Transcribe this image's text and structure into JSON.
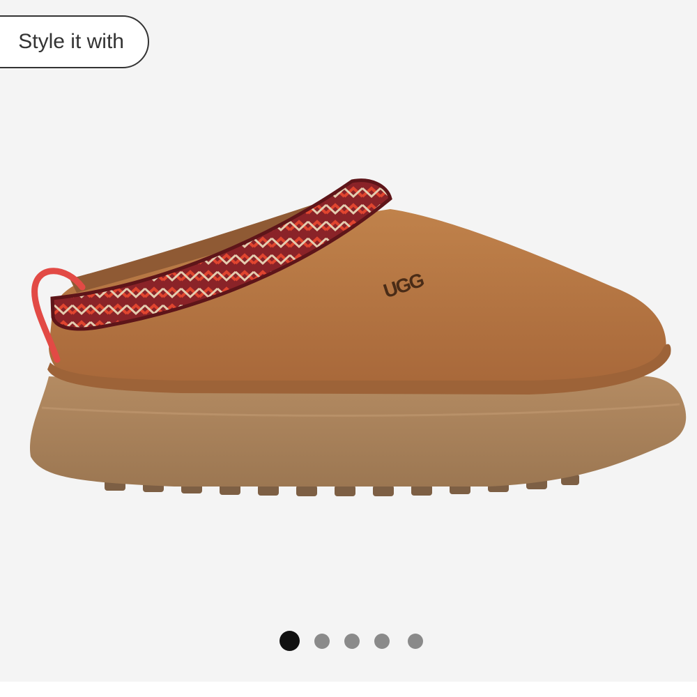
{
  "style_button": {
    "label": "Style it with"
  },
  "product_image": {
    "brand_logo": "UGG",
    "description_icon": "clog-slipper-image"
  },
  "carousel": {
    "count": 5,
    "active_index": 0
  },
  "colors": {
    "background": "#f4f4f4",
    "suede": "#b5733f",
    "sole": "#a98158",
    "trim_red": "#c73034",
    "trim_maroon": "#7b1f25",
    "dot_active": "#111111",
    "dot_inactive": "#8a8a8a"
  }
}
